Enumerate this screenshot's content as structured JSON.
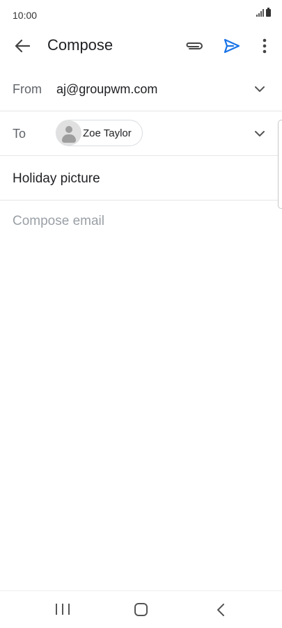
{
  "status_bar": {
    "time": "10:00"
  },
  "app_bar": {
    "title": "Compose",
    "icons": {
      "back": "arrow-left-icon",
      "attach": "paperclip-icon",
      "send": "send-icon",
      "more": "more-vert-icon"
    },
    "send_color": "#1a73e8"
  },
  "from_row": {
    "label": "From",
    "value": "aj@groupwm.com"
  },
  "to_row": {
    "label": "To",
    "recipients": [
      {
        "name": "Zoe Taylor"
      }
    ]
  },
  "subject": {
    "value": "Holiday picture"
  },
  "body": {
    "placeholder": "Compose email"
  }
}
